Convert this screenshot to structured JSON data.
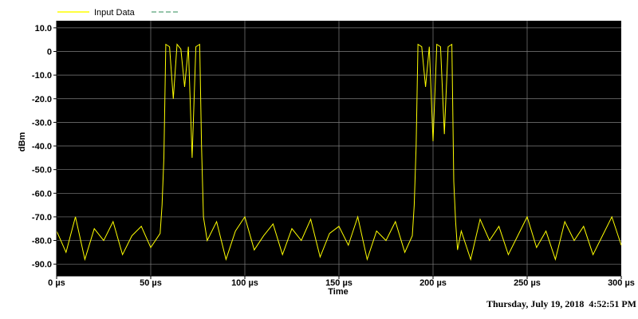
{
  "colors": {
    "plot_background": "#000000",
    "trace": "#ffff00",
    "grid": "#808080",
    "legend_second_entry": "#2e8b57"
  },
  "legend": {
    "entries": [
      {
        "label": "Input Data",
        "color": "#ffff00",
        "style": "solid"
      },
      {
        "label": "",
        "color": "#2e8b57",
        "style": "dashed"
      }
    ]
  },
  "timestamp": "Thursday, July 19, 2018  4:52:51 PM",
  "chart_data": {
    "type": "line",
    "title": "",
    "xlabel": "Time",
    "ylabel": "dBm",
    "x_unit": "µs",
    "xlim": [
      0,
      300
    ],
    "ylim": [
      -95,
      13
    ],
    "grid": true,
    "legend_position": "top-left",
    "x_ticks": [
      0,
      50,
      100,
      150,
      200,
      250,
      300
    ],
    "x_tick_labels": [
      "0 µs",
      "50 µs",
      "100 µs",
      "150 µs",
      "200 µs",
      "250 µs",
      "300 µs"
    ],
    "y_ticks": [
      10,
      0,
      -10,
      -20,
      -30,
      -40,
      -50,
      -60,
      -70,
      -80,
      -90
    ],
    "y_tick_labels": [
      "10.0",
      "0",
      "-10.0",
      "-20.0",
      "-30.0",
      "-40.0",
      "-50.0",
      "-60.0",
      "-70.0",
      "-80.0",
      "-90.0"
    ],
    "series": [
      {
        "name": "Input Data",
        "color": "#ffff00",
        "x": [
          0,
          5,
          10,
          15,
          20,
          25,
          30,
          35,
          40,
          45,
          50,
          55,
          56,
          57,
          58,
          60,
          62,
          64,
          66,
          68,
          70,
          72,
          74,
          76,
          77,
          78,
          80,
          85,
          90,
          95,
          100,
          105,
          110,
          115,
          120,
          125,
          130,
          135,
          140,
          145,
          150,
          155,
          160,
          165,
          170,
          175,
          180,
          185,
          189,
          190,
          191,
          192,
          194,
          196,
          198,
          200,
          202,
          204,
          206,
          208,
          210,
          211,
          212,
          213,
          215,
          220,
          225,
          230,
          235,
          240,
          245,
          250,
          255,
          260,
          265,
          270,
          275,
          280,
          285,
          290,
          295,
          300
        ],
        "y": [
          -76,
          -85,
          -70,
          -88,
          -75,
          -80,
          -72,
          -86,
          -78,
          -74,
          -83,
          -77,
          -65,
          -45,
          3,
          2,
          -20,
          3,
          1,
          -15,
          2,
          -45,
          2,
          3,
          -40,
          -70,
          -80,
          -72,
          -88,
          -76,
          -70,
          -84,
          -78,
          -73,
          -86,
          -75,
          -80,
          -71,
          -87,
          -77,
          -74,
          -82,
          -70,
          -88,
          -76,
          -80,
          -72,
          -85,
          -78,
          -65,
          -40,
          3,
          2,
          -15,
          2,
          -38,
          3,
          2,
          -35,
          2,
          3,
          -55,
          -72,
          -84,
          -76,
          -88,
          -71,
          -80,
          -74,
          -86,
          -78,
          -70,
          -83,
          -76,
          -88,
          -72,
          -80,
          -74,
          -86,
          -78,
          -70,
          -82
        ]
      }
    ]
  }
}
